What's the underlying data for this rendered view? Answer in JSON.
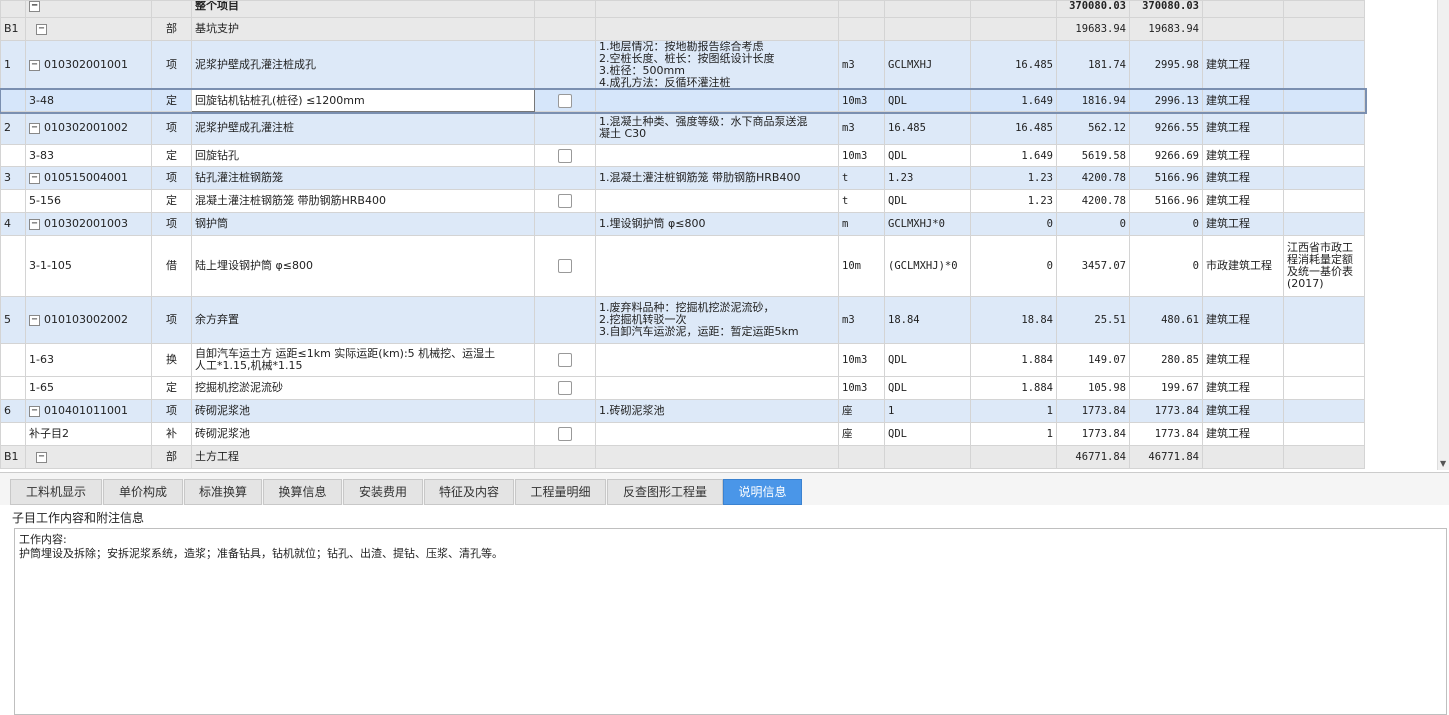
{
  "grid": {
    "header": {
      "label": "整个项目",
      "total1": "370080.03",
      "total2": "370080.03"
    },
    "part1": {
      "code": "B1",
      "type": "部",
      "name": "基坑支护",
      "total1": "19683.94",
      "total2": "19683.94"
    },
    "rows": [
      {
        "no": "1",
        "code": "010302001001",
        "type": "项",
        "name": "泥浆护壁成孔灌注桩成孔",
        "feat": [
          "1.地层情况：按地勘报告综合考虑",
          "2.空桩长度、桩长：按图纸设计长度",
          "3.桩径：500mm",
          "4.成孔方法：反循环灌注桩"
        ],
        "unit": "m3",
        "expr": "GCLMXHJ",
        "qty": "16.485",
        "price": "181.74",
        "total": "2995.98",
        "spec": "建筑工程"
      },
      {
        "no": "",
        "code": "3-48",
        "type": "定",
        "name": "回旋钻机钻桩孔(桩径) ≤1200mm",
        "feat": [],
        "unit": "10m3",
        "expr": "QDL",
        "qty": "1.649",
        "price": "1816.94",
        "total": "2996.13",
        "spec": "建筑工程"
      },
      {
        "no": "2",
        "code": "010302001002",
        "type": "项",
        "name": "泥浆护壁成孔灌注桩",
        "feat": [
          "1.混凝土种类、强度等级：水下商品泵送混",
          "凝土 C30"
        ],
        "unit": "m3",
        "expr": "16.485",
        "qty": "16.485",
        "price": "562.12",
        "total": "9266.55",
        "spec": "建筑工程"
      },
      {
        "no": "",
        "code": "3-83",
        "type": "定",
        "name": "回旋钻孔",
        "feat": [],
        "unit": "10m3",
        "expr": "QDL",
        "qty": "1.649",
        "price": "5619.58",
        "total": "9266.69",
        "spec": "建筑工程"
      },
      {
        "no": "3",
        "code": "010515004001",
        "type": "项",
        "name": "钻孔灌注桩钢筋笼",
        "feat": [
          "1.混凝土灌注桩钢筋笼 带肋钢筋HRB400"
        ],
        "unit": "t",
        "expr": "1.23",
        "qty": "1.23",
        "price": "4200.78",
        "total": "5166.96",
        "spec": "建筑工程"
      },
      {
        "no": "",
        "code": "5-156",
        "type": "定",
        "name": "混凝土灌注桩钢筋笼 带肋钢筋HRB400",
        "feat": [],
        "unit": "t",
        "expr": "QDL",
        "qty": "1.23",
        "price": "4200.78",
        "total": "5166.96",
        "spec": "建筑工程"
      },
      {
        "no": "4",
        "code": "010302001003",
        "type": "项",
        "name": "钢护筒",
        "feat": [
          "1.埋设钢护筒 φ≤800"
        ],
        "unit": "m",
        "expr": "GCLMXHJ*0",
        "qty": "0",
        "price": "0",
        "total": "0",
        "spec": "建筑工程"
      },
      {
        "no": "",
        "code": "3-1-105",
        "type": "借",
        "name": "陆上埋设钢护筒 φ≤800",
        "feat": [],
        "unit": "10m",
        "expr": "(GCLMXHJ)*0",
        "qty": "0",
        "price": "3457.07",
        "total": "0",
        "spec": "市政建筑工程",
        "note": [
          "江西省市政工",
          "程消耗量定额",
          "及统一基价表",
          "(2017)"
        ]
      },
      {
        "no": "5",
        "code": "010103002002",
        "type": "项",
        "name": "余方弃置",
        "feat": [
          "1.废弃料品种：挖掘机挖淤泥流砂，",
          "2.挖掘机转驳一次",
          "3.自卸汽车运淤泥，运距：暂定运距5km"
        ],
        "unit": "m3",
        "expr": "18.84",
        "qty": "18.84",
        "price": "25.51",
        "total": "480.61",
        "spec": "建筑工程"
      },
      {
        "no": "",
        "code": "1-63",
        "type": "换",
        "name2": [
          "自卸汽车运土方 运距≤1km  实际运距(km):5  机械挖、运湿土",
          "人工*1.15,机械*1.15"
        ],
        "feat": [],
        "unit": "10m3",
        "expr": "QDL",
        "qty": "1.884",
        "price": "149.07",
        "total": "280.85",
        "spec": "建筑工程"
      },
      {
        "no": "",
        "code": "1-65",
        "type": "定",
        "name": "挖掘机挖淤泥流砂",
        "feat": [],
        "unit": "10m3",
        "expr": "QDL",
        "qty": "1.884",
        "price": "105.98",
        "total": "199.67",
        "spec": "建筑工程"
      },
      {
        "no": "6",
        "code": "010401011001",
        "type": "项",
        "name": "砖砌泥浆池",
        "feat": [
          "1.砖砌泥浆池"
        ],
        "unit": "座",
        "expr": "1",
        "qty": "1",
        "price": "1773.84",
        "total": "1773.84",
        "spec": "建筑工程"
      },
      {
        "no": "",
        "code": "补子目2",
        "type": "补",
        "name": "砖砌泥浆池",
        "feat": [],
        "unit": "座",
        "expr": "QDL",
        "qty": "1",
        "price": "1773.84",
        "total": "1773.84",
        "spec": "建筑工程"
      }
    ],
    "part2": {
      "code": "B1",
      "type": "部",
      "name": "土方工程",
      "total1": "46771.84",
      "total2": "46771.84"
    }
  },
  "tabs": [
    "工料机显示",
    "单价构成",
    "标准换算",
    "换算信息",
    "安装费用",
    "特征及内容",
    "工程量明细",
    "反查图形工程量",
    "说明信息"
  ],
  "info": {
    "label": "子目工作内容和附注信息",
    "line1": "工作内容:",
    "line2": "护筒埋设及拆除；安拆泥浆系统，造浆；准备钻具，钻机就位；钻孔、出渣、提钻、压浆、清孔等。"
  },
  "icons": {
    "collapse": "minus-toggle-icon",
    "checkbox": "checkbox-icon",
    "scroll": "scroll-down-arrow-icon"
  },
  "colors": {
    "item_row": "#dde9f8",
    "active_tab": "#4a96e8",
    "part_row": "#e9e9e9"
  }
}
